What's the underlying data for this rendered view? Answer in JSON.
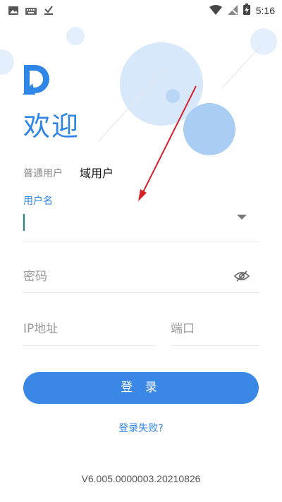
{
  "status_bar": {
    "time": "5:16",
    "left_icons": [
      "image-icon",
      "keyboard-icon",
      "check-download-icon"
    ],
    "right_icons": [
      "wifi-icon",
      "no-signal-icon",
      "battery-charging-icon"
    ]
  },
  "header": {
    "title": "欢迎"
  },
  "tabs": {
    "normal_user": "普通用户",
    "domain_user": "域用户"
  },
  "username": {
    "label": "用户名"
  },
  "password": {
    "placeholder": "密码"
  },
  "ip": {
    "placeholder": "IP地址"
  },
  "port": {
    "placeholder": "端口"
  },
  "login_button": {
    "label": "登 录"
  },
  "login_failed_link": {
    "label": "登录失败?"
  },
  "version": "V6.005.0000003.20210826",
  "colors": {
    "accent": "#2f86e6",
    "button": "#3b87e6",
    "cursor": "#15907f",
    "annotation_arrow": "#d6202a"
  }
}
